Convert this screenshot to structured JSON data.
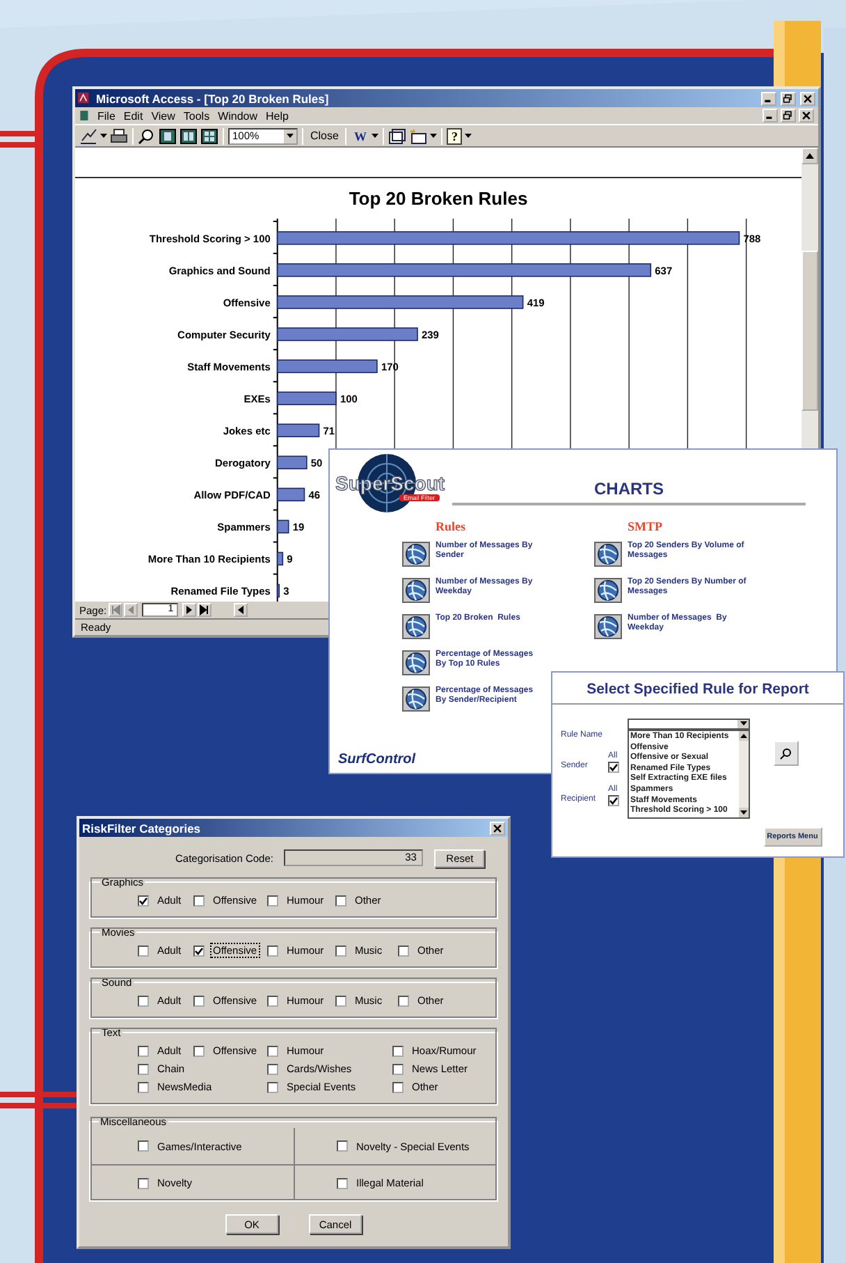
{
  "access_window": {
    "title": "Microsoft Access - [Top 20 Broken Rules]",
    "menu": [
      "File",
      "Edit",
      "View",
      "Tools",
      "Window",
      "Help"
    ],
    "toolbar": {
      "zoom": "100%",
      "close": "Close",
      "export_glyph": "W",
      "help_glyph": "?"
    },
    "report": {
      "chart_data": {
        "type": "bar",
        "orientation": "horizontal",
        "title": "Top 20 Broken Rules",
        "xlim": [
          0,
          800
        ],
        "data_labels": true,
        "categories": [
          "Threshold Scoring > 100",
          "Graphics and Sound",
          "Offensive",
          "Computer Security",
          "Staff Movements",
          "EXEs",
          "Jokes etc",
          "Derogatory",
          "Allow PDF/CAD",
          "Spammers",
          "More Than 10 Recipients",
          "Renamed File Types"
        ],
        "series": [
          {
            "color": "#6b7fc8",
            "values": [
              788,
              637,
              419,
              239,
              170,
              100,
              71,
              50,
              46,
              19,
              9,
              3
            ]
          }
        ]
      }
    },
    "page_nav": {
      "label": "Page:",
      "value": "1"
    },
    "status": "Ready"
  },
  "charts_window": {
    "logo": "SuperScout",
    "logo_badge": "Email Filter",
    "title": "CHARTS",
    "brand": "SurfControl",
    "columns": [
      {
        "heading": "Rules",
        "items": [
          "Number of Messages By Sender",
          "Number of Messages By Weekday",
          "Top 20 Broken  Rules",
          "Percentage of Messages By Top 10 Rules",
          "Percentage of Messages By Sender/Recipient"
        ]
      },
      {
        "heading": "SMTP",
        "items": [
          "Top 20 Senders By Volume of Messages",
          "Top 20 Senders By Number of Messages",
          "Number of Messages  By Weekday"
        ]
      }
    ]
  },
  "rule_window": {
    "title": "Select Specified Rule for Report",
    "rule_label": "Rule Name",
    "filters": [
      {
        "label": "Sender",
        "all_label": "All",
        "checked": true
      },
      {
        "label": "Recipient",
        "all_label": "All",
        "checked": true
      }
    ],
    "list": [
      "More Than 10 Recipients",
      "Offensive",
      "Offensive or Sexual",
      "Renamed File Types",
      "Self Extracting EXE files",
      "Spammers",
      "Staff Movements",
      "Threshold Scoring > 100"
    ],
    "button": "Reports Menu"
  },
  "riskfilter": {
    "title": "RiskFilter Categories",
    "code_label": "Categorisation Code:",
    "code": "33",
    "reset": "Reset",
    "groups": [
      {
        "title": "Graphics",
        "rows": [
          [
            {
              "label": "Adult",
              "checked": true
            },
            {
              "label": "Offensive",
              "checked": false
            },
            {
              "label": "Humour",
              "checked": false
            },
            {
              "label": "Other",
              "checked": false
            }
          ]
        ]
      },
      {
        "title": "Movies",
        "rows": [
          [
            {
              "label": "Adult",
              "checked": false,
              "focused": false
            },
            {
              "label": "Offensive",
              "checked": true,
              "focused": true
            },
            {
              "label": "Humour",
              "checked": false,
              "focused": false
            },
            {
              "label": "Music",
              "checked": false,
              "focused": false
            },
            {
              "label": "Other",
              "checked": false,
              "focused": false
            }
          ]
        ]
      },
      {
        "title": "Sound",
        "rows": [
          [
            {
              "label": "Adult",
              "checked": false
            },
            {
              "label": "Offensive",
              "checked": false
            },
            {
              "label": "Humour",
              "checked": false
            },
            {
              "label": "Music",
              "checked": false
            },
            {
              "label": "Other",
              "checked": false
            }
          ]
        ]
      },
      {
        "title": "Text",
        "rows": [
          [
            {
              "label": "Adult",
              "checked": false
            },
            {
              "label": "Offensive",
              "checked": false
            },
            {
              "label": "Humour",
              "checked": false
            },
            {
              "label": "Hoax/Rumour",
              "checked": false
            }
          ],
          [
            {
              "label": "Chain",
              "checked": false
            },
            "",
            {
              "label": "Cards/Wishes",
              "checked": false
            },
            {
              "label": "News Letter",
              "checked": false
            }
          ],
          [
            {
              "label": "NewsMedia",
              "checked": false
            },
            "",
            {
              "label": "Special Events",
              "checked": false
            },
            {
              "label": "Other",
              "checked": false
            }
          ]
        ]
      }
    ],
    "misc": {
      "title": "Miscellaneous",
      "options": [
        {
          "label": "Games/Interactive",
          "checked": false
        },
        {
          "label": "Novelty - Special Events",
          "checked": false
        },
        {
          "label": "Novelty",
          "checked": false
        },
        {
          "label": "Illegal Material",
          "checked": false
        }
      ]
    },
    "buttons": [
      "OK",
      "Cancel"
    ]
  }
}
